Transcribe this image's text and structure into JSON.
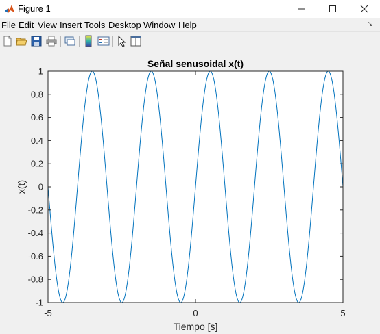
{
  "window": {
    "title": "Figure 1"
  },
  "menu": [
    {
      "label": "File",
      "u": "F",
      "rest": "ile"
    },
    {
      "label": "Edit",
      "u": "E",
      "rest": "dit"
    },
    {
      "label": "View",
      "u": "V",
      "rest": "iew"
    },
    {
      "label": "Insert",
      "u": "I",
      "rest": "nsert"
    },
    {
      "label": "Tools",
      "u": "T",
      "rest": "ools"
    },
    {
      "label": "Desktop",
      "u": "D",
      "rest": "esktop"
    },
    {
      "label": "Window",
      "u": "W",
      "rest": "indow"
    },
    {
      "label": "Help",
      "u": "H",
      "rest": "elp"
    }
  ],
  "toolbar": {
    "icons": [
      "new-figure-icon",
      "open-file-icon",
      "save-icon",
      "print-icon",
      "link-plot-icon",
      "insert-colorbar-icon",
      "insert-legend-icon",
      "edit-plot-icon",
      "property-inspector-icon"
    ]
  },
  "colors": {
    "line": "#0072BD",
    "axes_bg": "#ffffff",
    "figure_bg": "#f0f0f0"
  },
  "chart_data": {
    "type": "line",
    "title": "Señal senusoidal x(t)",
    "xlabel": "Tiempo [s]",
    "ylabel": "x(t)",
    "xlim": [
      -5,
      5
    ],
    "ylim": [
      -1,
      1
    ],
    "xticks": [
      "-5",
      "0",
      "5"
    ],
    "yticks": [
      "-1",
      "-0.8",
      "-0.6",
      "-0.4",
      "-0.2",
      "0",
      "0.2",
      "0.4",
      "0.6",
      "0.8",
      "1"
    ],
    "grid": false,
    "series": [
      {
        "function": "sin(pi*t)",
        "x_start": -5,
        "x_end": 5
      }
    ]
  }
}
